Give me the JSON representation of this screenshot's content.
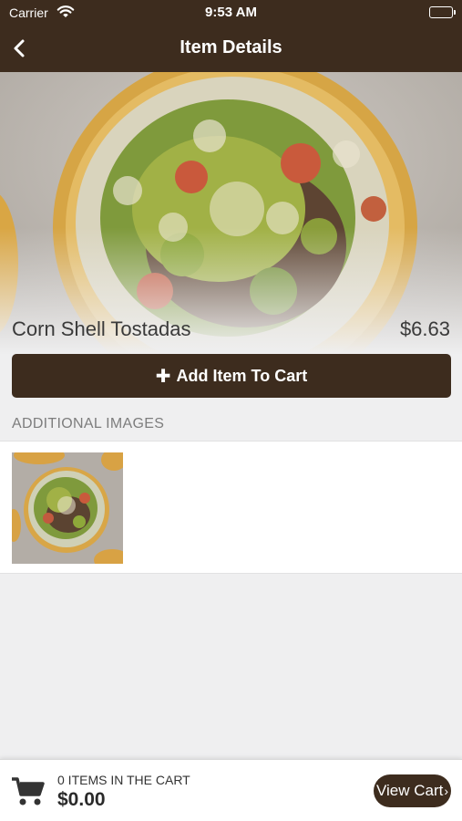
{
  "status_bar": {
    "carrier": "Carrier",
    "time": "9:53 AM",
    "wifi_icon": "wifi-icon",
    "battery_icon": "battery-icon"
  },
  "nav": {
    "title": "Item Details",
    "back_icon": "chevron-left-icon"
  },
  "item": {
    "name": "Corn Shell Tostadas",
    "price": "$6.63",
    "add_button_icon": "plus-icon",
    "add_button_label": "Add Item To Cart"
  },
  "additional_images": {
    "title": "ADDITIONAL IMAGES",
    "count": 1
  },
  "cart": {
    "icon": "cart-icon",
    "count_text": "0 ITEMS IN THE CART",
    "total": "$0.00",
    "view_label": "View Cart",
    "view_icon": "chevron-right-icon"
  },
  "colors": {
    "brand_brown": "#3d2c1e",
    "background": "#efeff0",
    "text_gray": "#7d7d7d"
  }
}
